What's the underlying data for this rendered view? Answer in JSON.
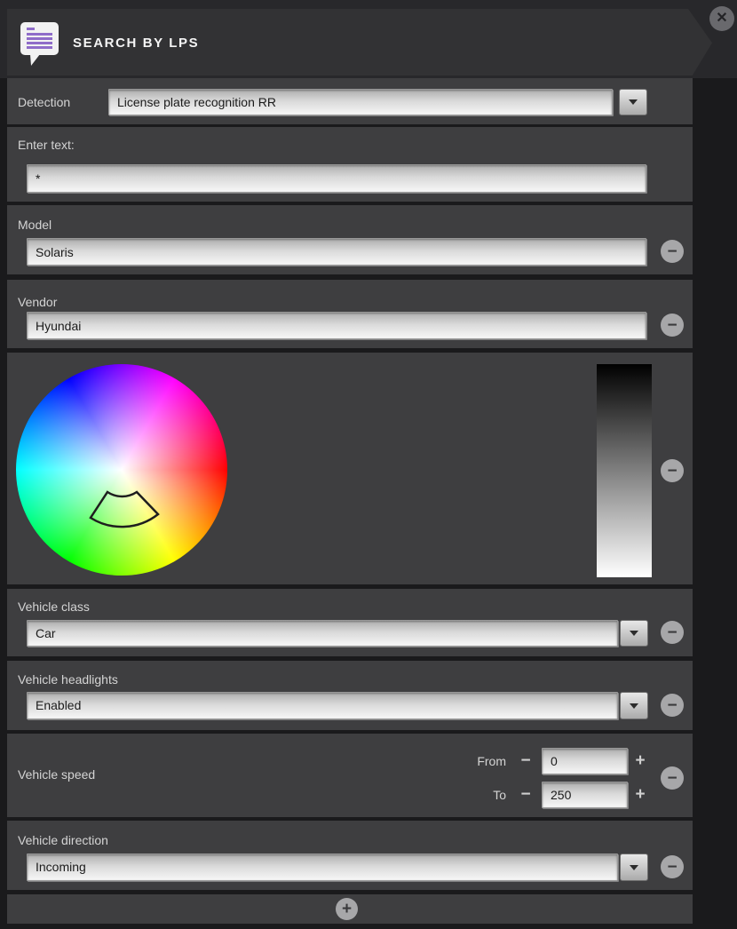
{
  "header": {
    "title": "SEARCH BY LPS",
    "icon": "speech-bubble-list-icon",
    "close_glyph": "✕"
  },
  "glyphs": {
    "minus": "−",
    "plus": "+",
    "dropdown": "chevron-down-icon"
  },
  "detection": {
    "label": "Detection",
    "value": "License plate recognition RR"
  },
  "enter_text": {
    "label": "Enter text:",
    "value": "*"
  },
  "model": {
    "label": "Model",
    "value": "Solaris"
  },
  "vendor": {
    "label": "Vendor",
    "value": "Hyundai"
  },
  "color_filter": {
    "wheel": "hsv-color-wheel",
    "value_bar": "brightness-gradient-bar",
    "selection": "arc-segment-marker-lower-left"
  },
  "vehicle_class": {
    "label": "Vehicle class",
    "value": "Car"
  },
  "vehicle_headlights": {
    "label": "Vehicle headlights",
    "value": "Enabled"
  },
  "vehicle_speed": {
    "label": "Vehicle speed",
    "from_label": "From",
    "from_value": "0",
    "to_label": "To",
    "to_value": "250"
  },
  "vehicle_direction": {
    "label": "Vehicle direction",
    "value": "Incoming"
  },
  "colors": {
    "page_bg": "#1a1a1c",
    "top_band_bg": "#28282b",
    "header_bg": "#323234",
    "section_bg": "#3e3e40",
    "accent_purple": "#8f6cc9",
    "label_text": "#d4d4d4",
    "field_text": "#1b1b1b"
  }
}
